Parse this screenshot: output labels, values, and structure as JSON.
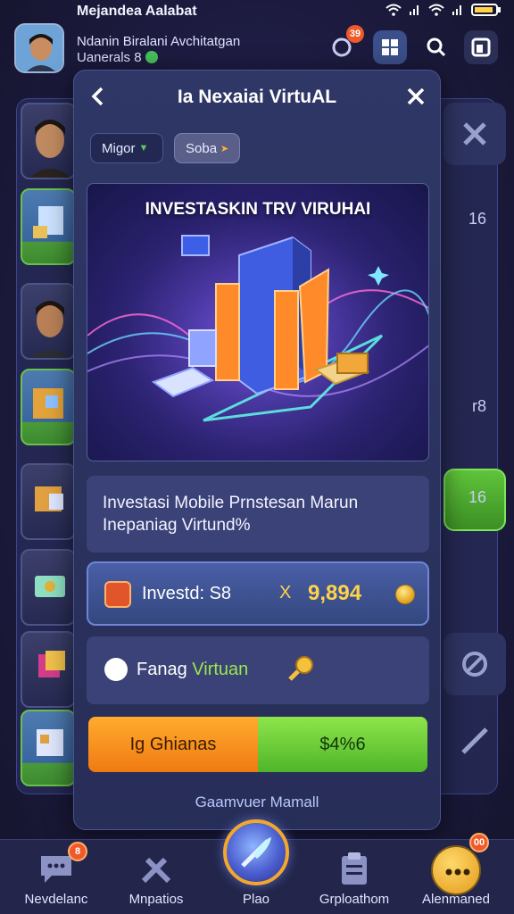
{
  "status_bar": {
    "title": "Mejandea Aalabat"
  },
  "header": {
    "line1": "Ndanin Biralani Avchitatgan",
    "line2": "Uanerals 8",
    "notification_badge": "39"
  },
  "background": {
    "numbers": [
      "16",
      "r8",
      "16"
    ]
  },
  "modal": {
    "title": "Ia Nexaiai VirtuAL",
    "chips": [
      {
        "label": "Migor"
      },
      {
        "label": "Soba"
      }
    ],
    "banner_title": "INVESTASKIN TRV VIRUHAI",
    "description": "Investasi Mobile Prnstesan Marun Inepaniag Virtund%",
    "invested_label": "Investd: S8",
    "invested_separator": "X",
    "invested_value": "9,894",
    "reward_label_prefix": "Fanag ",
    "reward_label_accent": "Virtuan",
    "action_left": "Ig Ghianas",
    "action_right": "$4%6",
    "footer_link": "Gaamvuer Mamall"
  },
  "bottom_nav": {
    "items": [
      {
        "label": "Nevdelanc",
        "badge": "8"
      },
      {
        "label": "Mnpatios"
      },
      {
        "label": "Plao"
      },
      {
        "label": "Grploathom"
      },
      {
        "label": "Alenmaned",
        "badge": "00"
      }
    ]
  },
  "colors": {
    "accent_gold": "#ffd34a",
    "accent_green": "#9be84a",
    "modal_bg": "#2f3766",
    "badge_red": "#ef5a2a"
  }
}
